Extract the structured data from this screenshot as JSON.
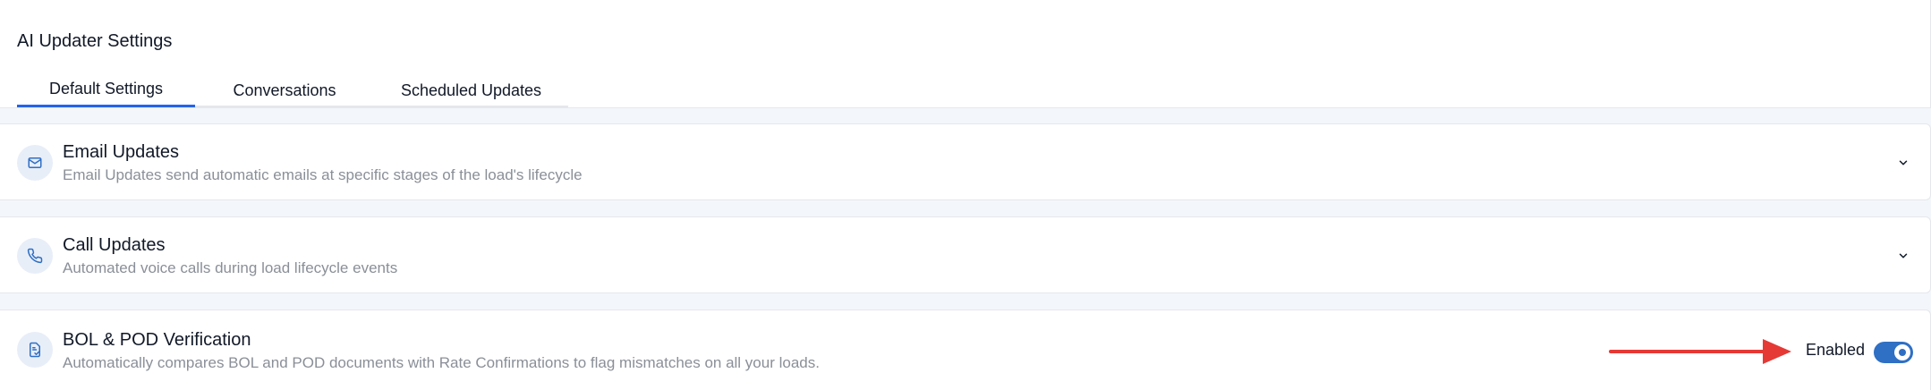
{
  "page": {
    "title": "AI Updater Settings"
  },
  "tabs": [
    {
      "label": "Default Settings",
      "active": true
    },
    {
      "label": "Conversations",
      "active": false
    },
    {
      "label": "Scheduled Updates",
      "active": false
    }
  ],
  "sections": [
    {
      "title": "Email Updates",
      "description": "Email Updates send automatic emails at specific stages of the load's lifecycle",
      "icon": "mail-icon",
      "control": "chevron-down-icon"
    },
    {
      "title": "Call Updates",
      "description": "Automated voice calls during load lifecycle events",
      "icon": "phone-icon",
      "control": "chevron-down-icon"
    },
    {
      "title": "BOL & POD Verification",
      "description": "Automatically compares BOL and POD documents with Rate Confirmations to flag mismatches on all your loads.",
      "icon": "document-check-icon",
      "status_label": "Enabled",
      "enabled": true
    }
  ],
  "annotation": {
    "icon": "red-arrow-icon",
    "color": "#e53935"
  },
  "colors": {
    "accent": "#2563eb",
    "toggle_on": "#2f6fc4",
    "icon_bg": "#e8eef8",
    "muted_text": "#8a8f98"
  }
}
